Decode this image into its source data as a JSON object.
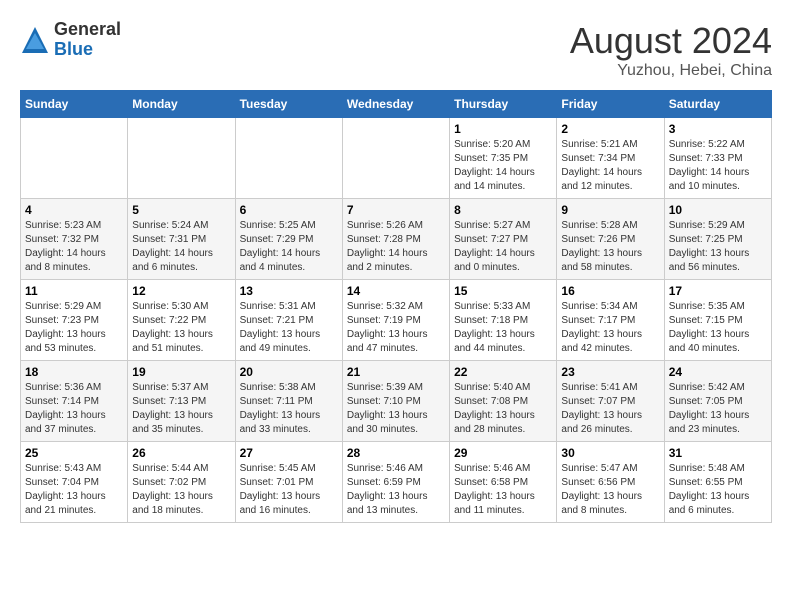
{
  "logo": {
    "general": "General",
    "blue": "Blue"
  },
  "title": {
    "month_year": "August 2024",
    "location": "Yuzhou, Hebei, China"
  },
  "headers": [
    "Sunday",
    "Monday",
    "Tuesday",
    "Wednesday",
    "Thursday",
    "Friday",
    "Saturday"
  ],
  "weeks": [
    [
      {
        "day": "",
        "content": ""
      },
      {
        "day": "",
        "content": ""
      },
      {
        "day": "",
        "content": ""
      },
      {
        "day": "",
        "content": ""
      },
      {
        "day": "1",
        "content": "Sunrise: 5:20 AM\nSunset: 7:35 PM\nDaylight: 14 hours\nand 14 minutes."
      },
      {
        "day": "2",
        "content": "Sunrise: 5:21 AM\nSunset: 7:34 PM\nDaylight: 14 hours\nand 12 minutes."
      },
      {
        "day": "3",
        "content": "Sunrise: 5:22 AM\nSunset: 7:33 PM\nDaylight: 14 hours\nand 10 minutes."
      }
    ],
    [
      {
        "day": "4",
        "content": "Sunrise: 5:23 AM\nSunset: 7:32 PM\nDaylight: 14 hours\nand 8 minutes."
      },
      {
        "day": "5",
        "content": "Sunrise: 5:24 AM\nSunset: 7:31 PM\nDaylight: 14 hours\nand 6 minutes."
      },
      {
        "day": "6",
        "content": "Sunrise: 5:25 AM\nSunset: 7:29 PM\nDaylight: 14 hours\nand 4 minutes."
      },
      {
        "day": "7",
        "content": "Sunrise: 5:26 AM\nSunset: 7:28 PM\nDaylight: 14 hours\nand 2 minutes."
      },
      {
        "day": "8",
        "content": "Sunrise: 5:27 AM\nSunset: 7:27 PM\nDaylight: 14 hours\nand 0 minutes."
      },
      {
        "day": "9",
        "content": "Sunrise: 5:28 AM\nSunset: 7:26 PM\nDaylight: 13 hours\nand 58 minutes."
      },
      {
        "day": "10",
        "content": "Sunrise: 5:29 AM\nSunset: 7:25 PM\nDaylight: 13 hours\nand 56 minutes."
      }
    ],
    [
      {
        "day": "11",
        "content": "Sunrise: 5:29 AM\nSunset: 7:23 PM\nDaylight: 13 hours\nand 53 minutes."
      },
      {
        "day": "12",
        "content": "Sunrise: 5:30 AM\nSunset: 7:22 PM\nDaylight: 13 hours\nand 51 minutes."
      },
      {
        "day": "13",
        "content": "Sunrise: 5:31 AM\nSunset: 7:21 PM\nDaylight: 13 hours\nand 49 minutes."
      },
      {
        "day": "14",
        "content": "Sunrise: 5:32 AM\nSunset: 7:19 PM\nDaylight: 13 hours\nand 47 minutes."
      },
      {
        "day": "15",
        "content": "Sunrise: 5:33 AM\nSunset: 7:18 PM\nDaylight: 13 hours\nand 44 minutes."
      },
      {
        "day": "16",
        "content": "Sunrise: 5:34 AM\nSunset: 7:17 PM\nDaylight: 13 hours\nand 42 minutes."
      },
      {
        "day": "17",
        "content": "Sunrise: 5:35 AM\nSunset: 7:15 PM\nDaylight: 13 hours\nand 40 minutes."
      }
    ],
    [
      {
        "day": "18",
        "content": "Sunrise: 5:36 AM\nSunset: 7:14 PM\nDaylight: 13 hours\nand 37 minutes."
      },
      {
        "day": "19",
        "content": "Sunrise: 5:37 AM\nSunset: 7:13 PM\nDaylight: 13 hours\nand 35 minutes."
      },
      {
        "day": "20",
        "content": "Sunrise: 5:38 AM\nSunset: 7:11 PM\nDaylight: 13 hours\nand 33 minutes."
      },
      {
        "day": "21",
        "content": "Sunrise: 5:39 AM\nSunset: 7:10 PM\nDaylight: 13 hours\nand 30 minutes."
      },
      {
        "day": "22",
        "content": "Sunrise: 5:40 AM\nSunset: 7:08 PM\nDaylight: 13 hours\nand 28 minutes."
      },
      {
        "day": "23",
        "content": "Sunrise: 5:41 AM\nSunset: 7:07 PM\nDaylight: 13 hours\nand 26 minutes."
      },
      {
        "day": "24",
        "content": "Sunrise: 5:42 AM\nSunset: 7:05 PM\nDaylight: 13 hours\nand 23 minutes."
      }
    ],
    [
      {
        "day": "25",
        "content": "Sunrise: 5:43 AM\nSunset: 7:04 PM\nDaylight: 13 hours\nand 21 minutes."
      },
      {
        "day": "26",
        "content": "Sunrise: 5:44 AM\nSunset: 7:02 PM\nDaylight: 13 hours\nand 18 minutes."
      },
      {
        "day": "27",
        "content": "Sunrise: 5:45 AM\nSunset: 7:01 PM\nDaylight: 13 hours\nand 16 minutes."
      },
      {
        "day": "28",
        "content": "Sunrise: 5:46 AM\nSunset: 6:59 PM\nDaylight: 13 hours\nand 13 minutes."
      },
      {
        "day": "29",
        "content": "Sunrise: 5:46 AM\nSunset: 6:58 PM\nDaylight: 13 hours\nand 11 minutes."
      },
      {
        "day": "30",
        "content": "Sunrise: 5:47 AM\nSunset: 6:56 PM\nDaylight: 13 hours\nand 8 minutes."
      },
      {
        "day": "31",
        "content": "Sunrise: 5:48 AM\nSunset: 6:55 PM\nDaylight: 13 hours\nand 6 minutes."
      }
    ]
  ]
}
